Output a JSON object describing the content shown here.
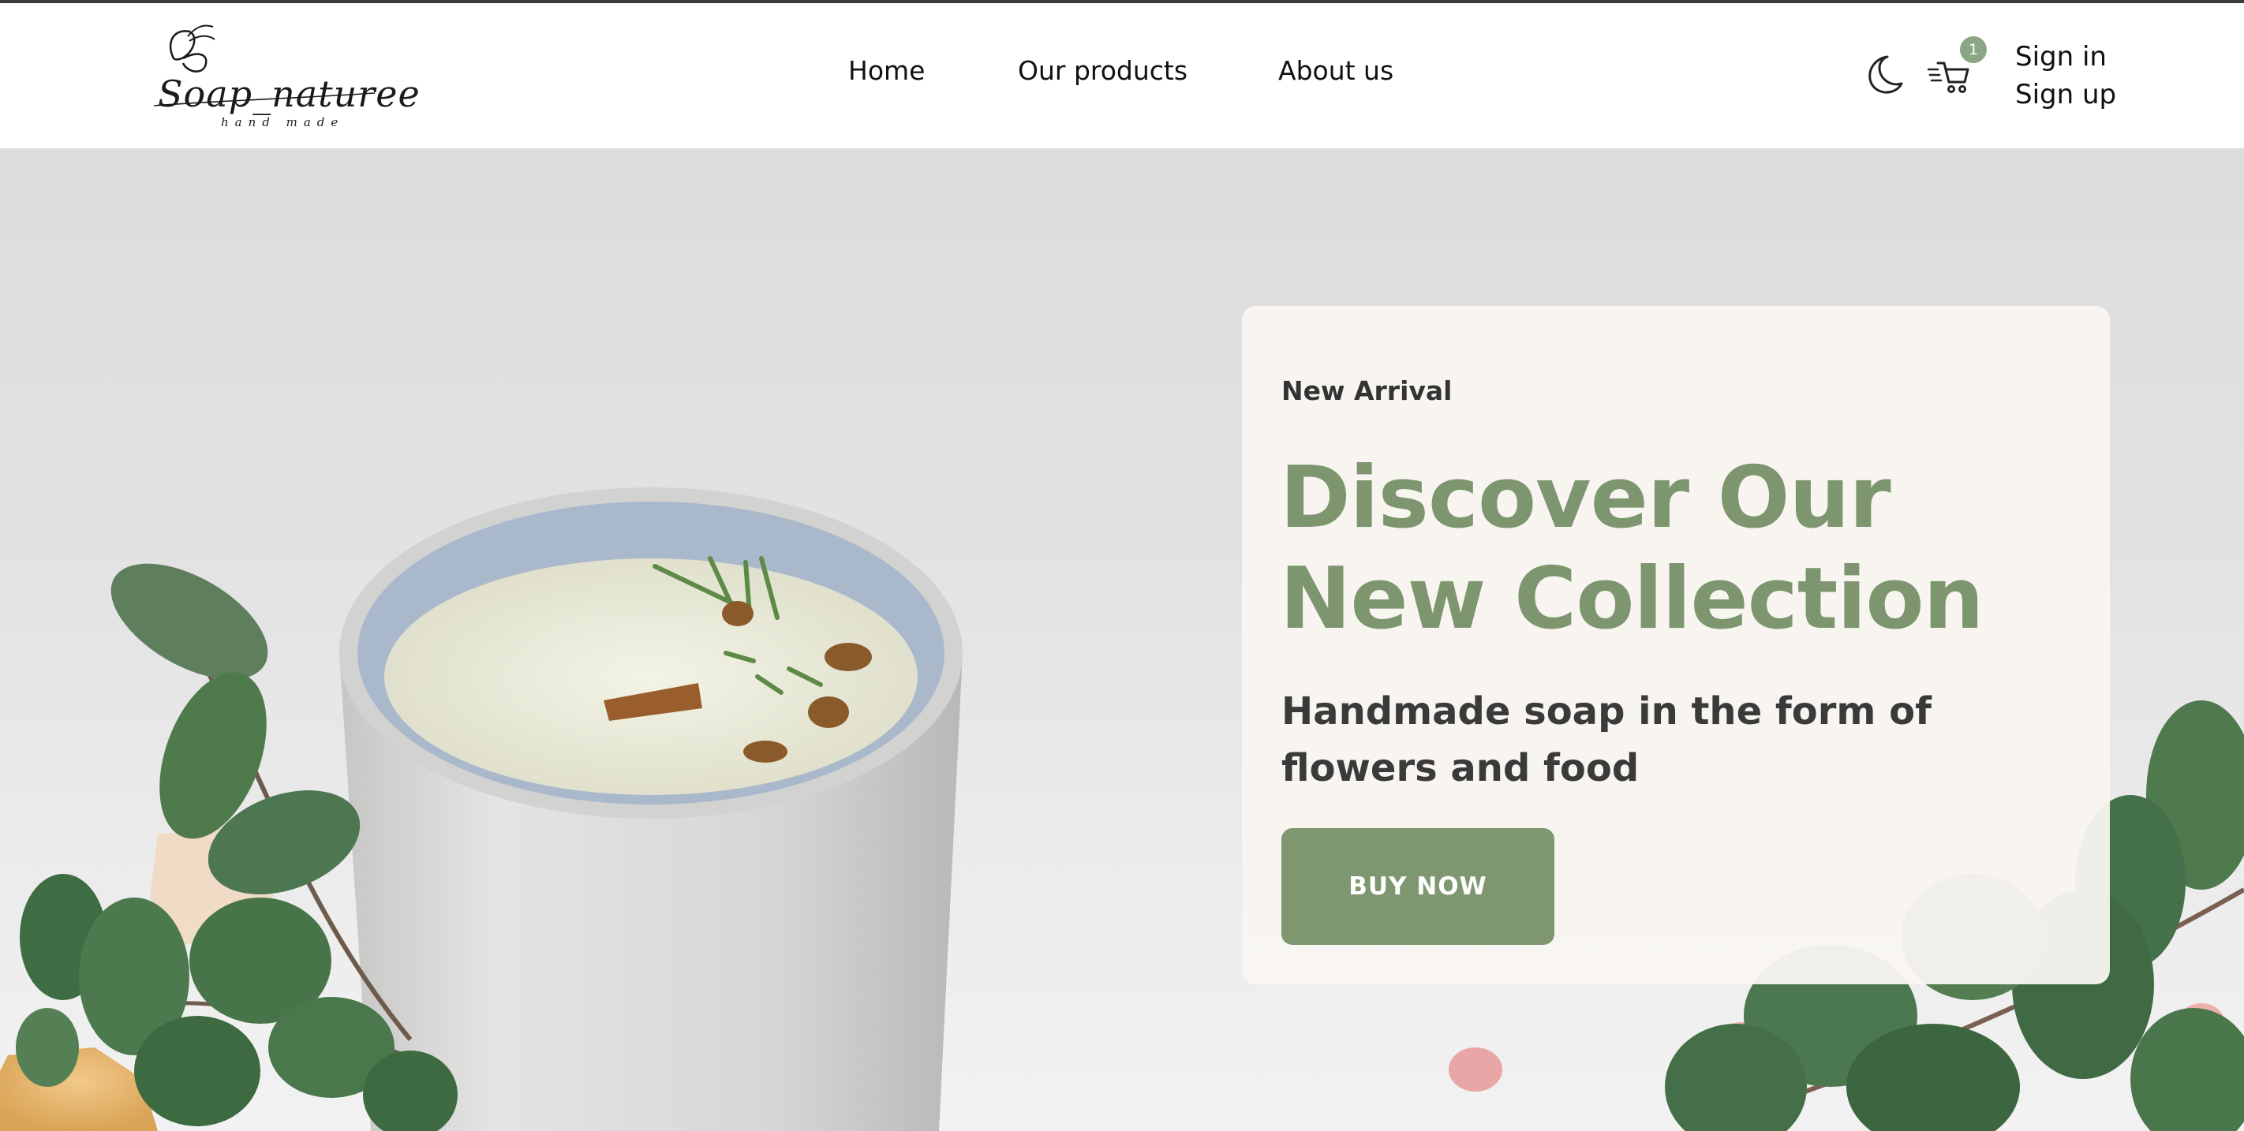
{
  "brand": {
    "name": "Soap_naturee",
    "tagline": "hand made"
  },
  "nav": {
    "items": [
      {
        "label": "Home"
      },
      {
        "label": "Our products"
      },
      {
        "label": "About us"
      }
    ]
  },
  "header_actions": {
    "theme_icon": "moon-icon",
    "cart_icon": "cart-icon",
    "cart_count": "1",
    "sign_in": "Sign in",
    "sign_up": "Sign up"
  },
  "hero": {
    "eyebrow": "New Arrival",
    "headline": "Discover Our New Collection",
    "subheadline": "Handmade soap in the form of flowers and food",
    "cta_label": "BUY NOW"
  },
  "colors": {
    "accent": "#7e9770",
    "badge": "#8aa684",
    "card_bg": "#f9f6f1",
    "text_dark": "#3a3a3a"
  }
}
